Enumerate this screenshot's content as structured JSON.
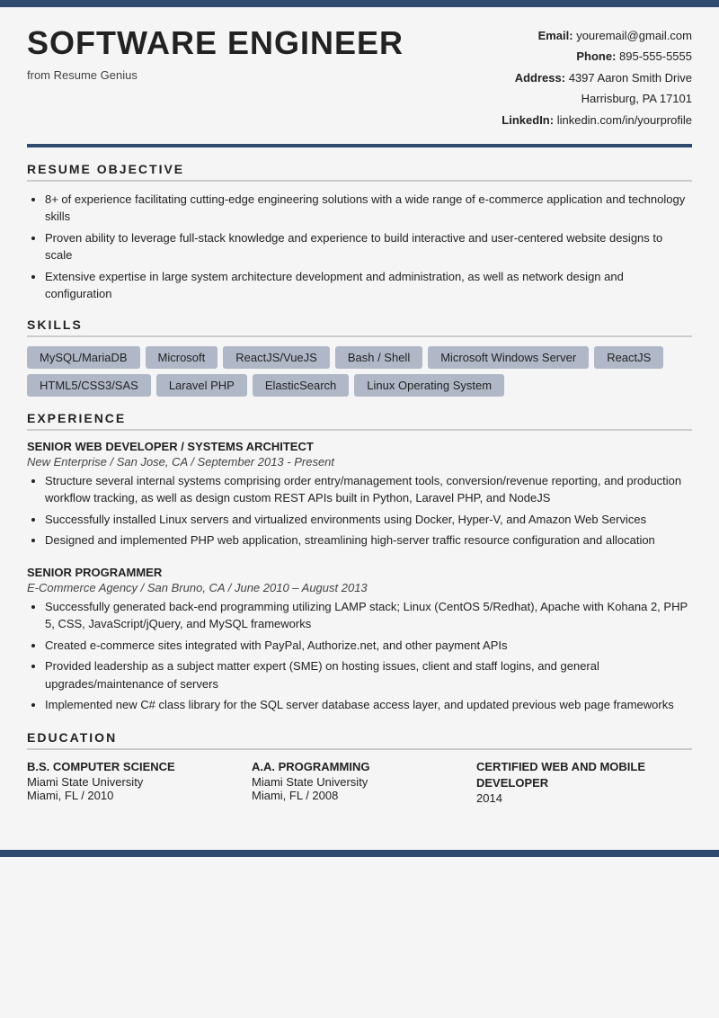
{
  "topbar": {},
  "header": {
    "title": "SOFTWARE ENGINEER",
    "subtitle": "from Resume Genius",
    "email_label": "Email:",
    "email_value": "youremail@gmail.com",
    "phone_label": "Phone:",
    "phone_value": "895-555-5555",
    "address_label": "Address:",
    "address_line1": "4397 Aaron Smith Drive",
    "address_line2": "Harrisburg, PA 17101",
    "linkedin_label": "LinkedIn:",
    "linkedin_value": "linkedin.com/in/yourprofile"
  },
  "sections": {
    "objective": {
      "title": "RESUME OBJECTIVE",
      "bullets": [
        "8+ of experience facilitating cutting-edge engineering solutions with a wide range of e-commerce application and technology skills",
        "Proven ability to leverage full-stack knowledge and experience to build interactive and user-centered website designs to scale",
        "Extensive expertise in large system architecture development and administration, as well as network design and configuration"
      ]
    },
    "skills": {
      "title": "SKILLS",
      "items": [
        "MySQL/MariaDB",
        "Microsoft",
        "ReactJS/VueJS",
        "Bash / Shell",
        "Microsoft Windows Server",
        "ReactJS",
        "HTML5/CSS3/SAS",
        "Laravel PHP",
        "ElasticSearch",
        "Linux Operating System"
      ]
    },
    "experience": {
      "title": "EXPERIENCE",
      "jobs": [
        {
          "title": "SENIOR WEB DEVELOPER / SYSTEMS ARCHITECT",
          "subtitle": "New Enterprise / San Jose, CA / September 2013 - Present",
          "bullets": [
            "Structure several internal systems comprising order entry/management tools, conversion/revenue reporting, and production workflow tracking, as well as design custom REST APIs built in Python, Laravel PHP, and NodeJS",
            "Successfully installed Linux servers and virtualized environments using Docker, Hyper-V, and Amazon Web Services",
            "Designed and implemented PHP web application, streamlining high-server traffic resource configuration and allocation"
          ]
        },
        {
          "title": "SENIOR PROGRAMMER",
          "subtitle": "E-Commerce Agency / San Bruno, CA / June 2010 – August 2013",
          "bullets": [
            "Successfully generated back-end programming utilizing LAMP stack; Linux (CentOS 5/Redhat), Apache with Kohana 2, PHP 5, CSS, JavaScript/jQuery, and MySQL frameworks",
            "Created e-commerce sites integrated with PayPal, Authorize.net, and other payment APIs",
            "Provided leadership as a subject matter expert (SME) on hosting issues, client and staff logins, and general upgrades/maintenance of servers",
            "Implemented new C# class library for the SQL server database access layer, and updated previous web page frameworks"
          ]
        }
      ]
    },
    "education": {
      "title": "EDUCATION",
      "entries": [
        {
          "degree": "B.S. COMPUTER SCIENCE",
          "school": "Miami State University",
          "detail": "Miami, FL / 2010"
        },
        {
          "degree": "A.A. PROGRAMMING",
          "school": "Miami State University",
          "detail": "Miami, FL / 2008"
        },
        {
          "degree": "CERTIFIED WEB AND MOBILE DEVELOPER",
          "school": "",
          "detail": "2014"
        }
      ]
    }
  }
}
